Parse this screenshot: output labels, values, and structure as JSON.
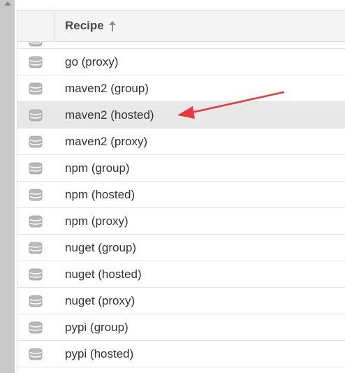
{
  "table": {
    "header": {
      "recipe_label": "Recipe",
      "sort": "ascending"
    },
    "rows": [
      {
        "name": "go (proxy)",
        "icon": "database-icon"
      },
      {
        "name": "maven2 (group)",
        "icon": "database-icon"
      },
      {
        "name": "maven2 (hosted)",
        "icon": "database-icon",
        "selected": true
      },
      {
        "name": "maven2 (proxy)",
        "icon": "database-icon"
      },
      {
        "name": "npm (group)",
        "icon": "database-icon"
      },
      {
        "name": "npm (hosted)",
        "icon": "database-icon"
      },
      {
        "name": "npm (proxy)",
        "icon": "database-icon"
      },
      {
        "name": "nuget (group)",
        "icon": "database-icon"
      },
      {
        "name": "nuget (hosted)",
        "icon": "database-icon"
      },
      {
        "name": "nuget (proxy)",
        "icon": "database-icon"
      },
      {
        "name": "pypi (group)",
        "icon": "database-icon"
      },
      {
        "name": "pypi (hosted)",
        "icon": "database-icon"
      }
    ]
  },
  "annotation": {
    "type": "red-arrow",
    "color": "#e8383d",
    "points_to": "maven2 (hosted)"
  },
  "colors": {
    "header_bg": "#f4f4f4",
    "selected_row_bg": "#e8e8e8",
    "left_bar": "#c9c9c9",
    "icon_color": "#b3b3b3"
  }
}
